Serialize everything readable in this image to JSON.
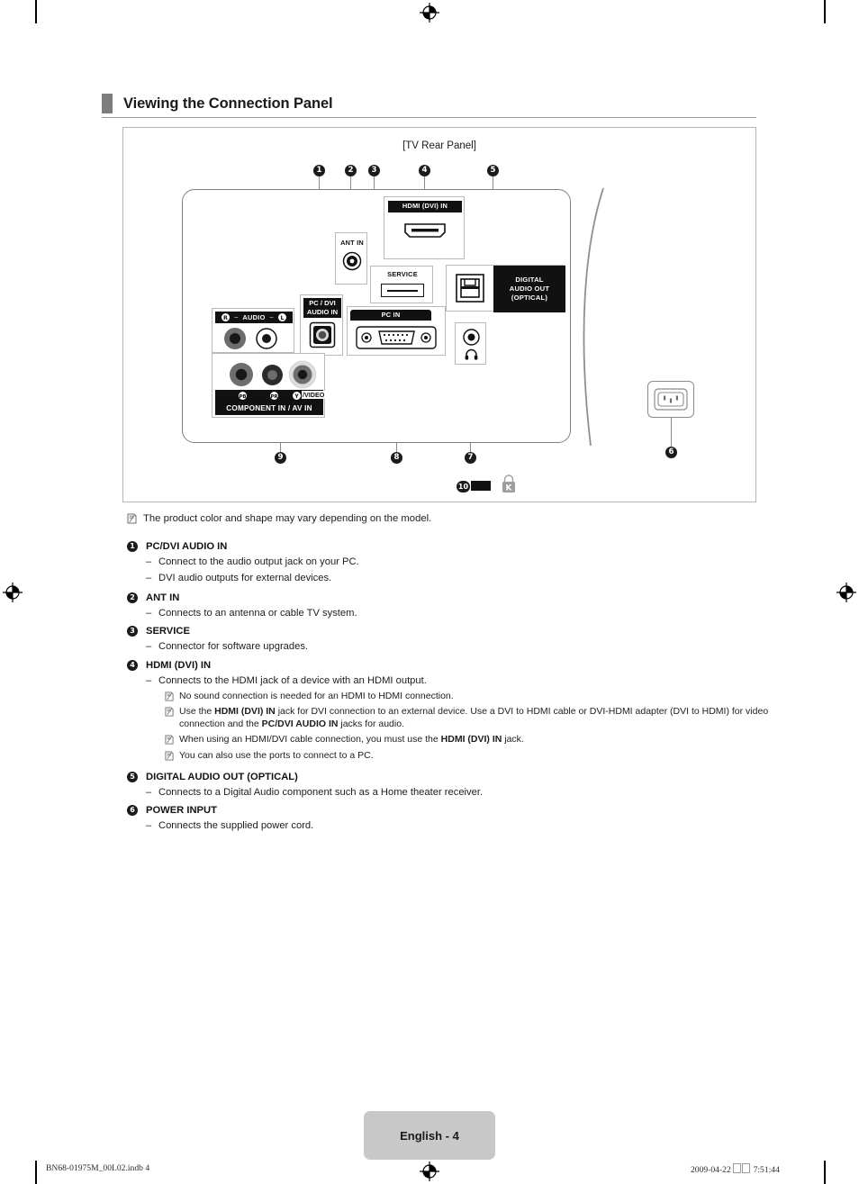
{
  "header": {
    "title": "Viewing the Connection Panel"
  },
  "figure": {
    "caption": "[TV Rear Panel]",
    "ports": {
      "hdmi": "HDMI (DVI)  IN",
      "ant_in": "ANT IN",
      "service": "SERVICE",
      "digital_audio_out": "DIGITAL\nAUDIO OUT\n(OPTICAL)",
      "digital_audio_out_line1": "DIGITAL",
      "digital_audio_out_line2": "AUDIO OUT",
      "digital_audio_out_line3": "(OPTICAL)",
      "pc_dvi_audio_in_line1": "PC / DVI",
      "pc_dvi_audio_in_line2": "AUDIO IN",
      "pc_in": "PC IN",
      "audio_label": "AUDIO",
      "audio_r": "R",
      "audio_l": "L",
      "component_av": "COMPONENT IN / AV IN",
      "comp_pb": "PB",
      "comp_pr": "PR",
      "comp_y_video": "Y / VIDEO",
      "headphone_icon": "headphone-icon",
      "kensington_icon": "kensington-lock-icon"
    },
    "callouts": [
      "1",
      "2",
      "3",
      "4",
      "5",
      "6",
      "7",
      "8",
      "9",
      "10"
    ]
  },
  "notes": {
    "top": "The product color and shape may vary depending on the model."
  },
  "items": [
    {
      "num": "1",
      "title": "PC/DVI AUDIO IN",
      "bullets": [
        "Connect to the audio output jack on your PC.",
        "DVI audio outputs for external devices."
      ]
    },
    {
      "num": "2",
      "title": "ANT IN",
      "bullets": [
        "Connects to an antenna or cable TV system."
      ]
    },
    {
      "num": "3",
      "title": "SERVICE",
      "bullets": [
        "Connector for software upgrades."
      ]
    },
    {
      "num": "4",
      "title": "HDMI (DVI) IN",
      "bullets": [
        "Connects to the HDMI jack of a device with an HDMI output."
      ],
      "subnotes": [
        "No sound connection is needed for an HDMI to HDMI connection.",
        "Use the HDMI (DVI) IN jack for DVI connection to an external device. Use a DVI to HDMI cable or DVI-HDMI adapter (DVI to HDMI) for video connection and the PC/DVI AUDIO IN jacks for audio.",
        "When using an HDMI/DVI cable connection, you must use the HDMI (DVI) IN jack.",
        "You can also use the ports to connect to a PC."
      ]
    },
    {
      "num": "5",
      "title": "DIGITAL AUDIO OUT (OPTICAL)",
      "bullets": [
        "Connects to a Digital Audio component such as a Home theater receiver."
      ]
    },
    {
      "num": "6",
      "title": "POWER INPUT",
      "bullets": [
        "Connects the supplied power cord."
      ]
    }
  ],
  "footer": {
    "page_label": "English - 4",
    "file_ref": "BN68-01975M_00L02.indb   4",
    "timestamp_date": "2009-04-22",
    "timestamp_time": "7:51:44"
  },
  "colors": {
    "accent_bar": "#7d7d7d",
    "page_tab_bg": "#c8c8c8",
    "callout_bg": "#1b1b1b",
    "frame_border": "#b5b5b5"
  }
}
